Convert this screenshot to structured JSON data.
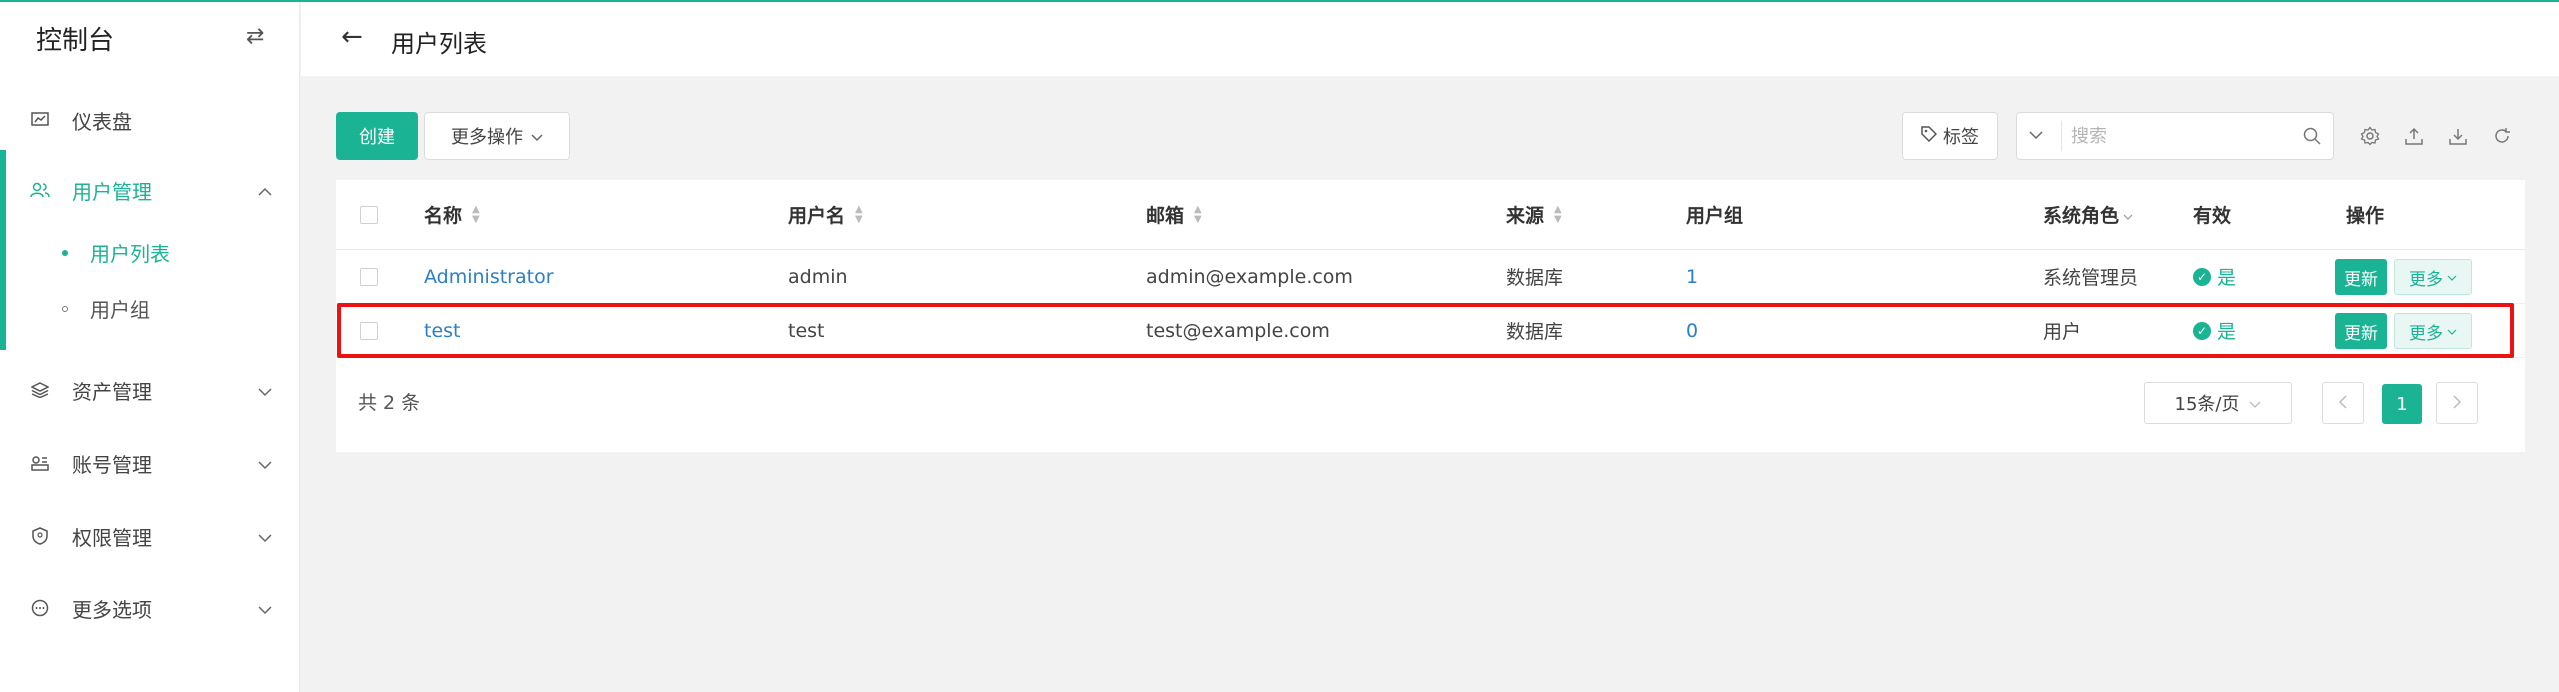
{
  "app": {
    "title": "控制台"
  },
  "sidebar": {
    "items": [
      {
        "label": "仪表盘",
        "icon": "dashboard-icon"
      },
      {
        "label": "用户管理",
        "icon": "users-icon",
        "expanded": true,
        "children": [
          {
            "label": "用户列表",
            "current": true
          },
          {
            "label": "用户组",
            "current": false
          }
        ]
      },
      {
        "label": "资产管理",
        "icon": "layers-icon"
      },
      {
        "label": "账号管理",
        "icon": "account-icon"
      },
      {
        "label": "权限管理",
        "icon": "shield-icon"
      },
      {
        "label": "更多选项",
        "icon": "more-circle-icon"
      }
    ]
  },
  "header": {
    "title": "用户列表"
  },
  "toolbar": {
    "create_label": "创建",
    "more_actions_label": "更多操作",
    "tag_label": "标签",
    "search_placeholder": "搜索"
  },
  "table": {
    "columns": [
      "名称",
      "用户名",
      "邮箱",
      "来源",
      "用户组",
      "系统角色",
      "有效",
      "操作"
    ],
    "rows": [
      {
        "name": "Administrator",
        "username": "admin",
        "email": "admin@example.com",
        "source": "数据库",
        "groups": "1",
        "role": "系统管理员",
        "active": "是",
        "update_label": "更新",
        "more_label": "更多"
      },
      {
        "name": "test",
        "username": "test",
        "email": "test@example.com",
        "source": "数据库",
        "groups": "0",
        "role": "用户",
        "active": "是",
        "update_label": "更新",
        "more_label": "更多"
      }
    ]
  },
  "pagination": {
    "total_text": "共 2 条",
    "page_size": "15条/页",
    "current_page": "1"
  },
  "colors": {
    "accent": "#1ab394",
    "link": "#2b7fc4",
    "highlight": "#ee1111"
  }
}
